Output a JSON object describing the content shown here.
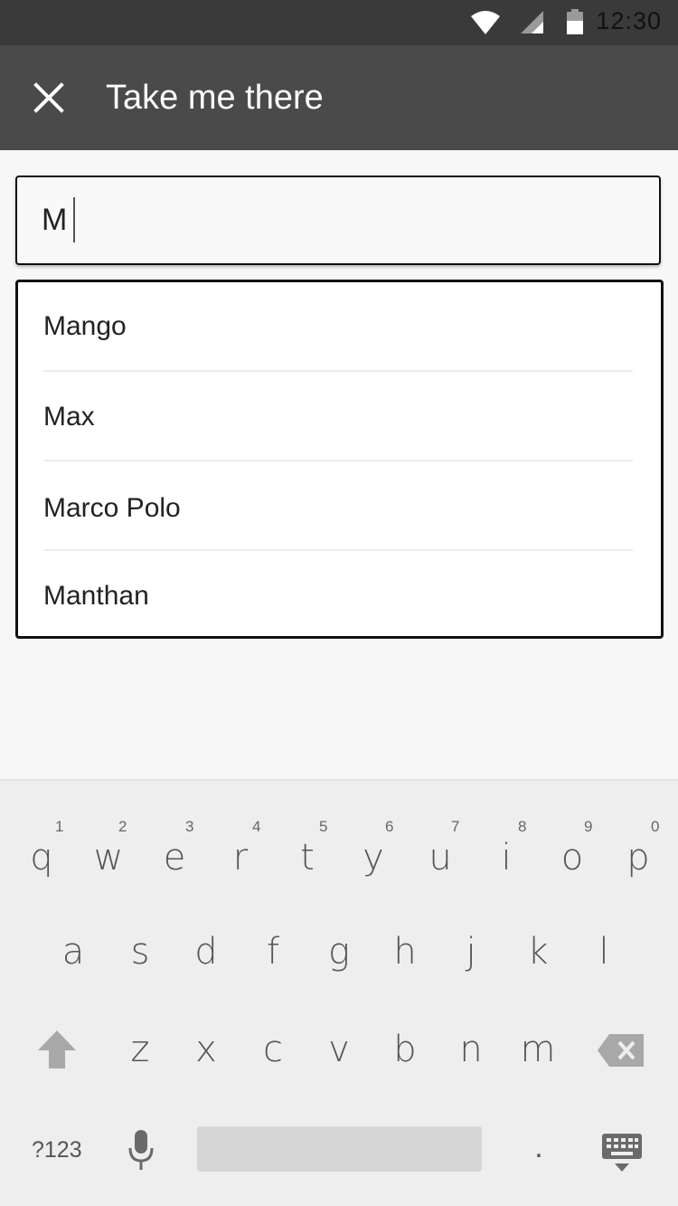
{
  "status_bar": {
    "time": "12:30"
  },
  "app_bar": {
    "title": "Take me there",
    "close_icon": "close-icon"
  },
  "search": {
    "value": "M"
  },
  "suggestions": [
    {
      "label": "Mango"
    },
    {
      "label": "Max"
    },
    {
      "label": "Marco Polo"
    },
    {
      "label": "Manthan"
    }
  ],
  "keyboard": {
    "row1": [
      {
        "ch": "q",
        "hint": "1"
      },
      {
        "ch": "w",
        "hint": "2"
      },
      {
        "ch": "e",
        "hint": "3"
      },
      {
        "ch": "r",
        "hint": "4"
      },
      {
        "ch": "t",
        "hint": "5"
      },
      {
        "ch": "y",
        "hint": "6"
      },
      {
        "ch": "u",
        "hint": "7"
      },
      {
        "ch": "i",
        "hint": "8"
      },
      {
        "ch": "o",
        "hint": "9"
      },
      {
        "ch": "p",
        "hint": "0"
      }
    ],
    "row2": [
      "a",
      "s",
      "d",
      "f",
      "g",
      "h",
      "j",
      "k",
      "l"
    ],
    "row3": [
      "z",
      "x",
      "c",
      "v",
      "b",
      "n",
      "m"
    ],
    "symbols_label": "?123",
    "period_label": "."
  },
  "colors": {
    "status_bar": "#3a3a3a",
    "app_bar": "#4a4a4a",
    "background": "#f7f7f7",
    "keyboard": "#eeeeee"
  }
}
